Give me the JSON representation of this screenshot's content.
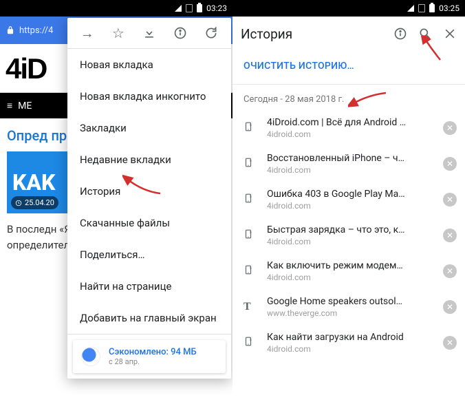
{
  "left": {
    "status": {
      "time": "03:23"
    },
    "urlbar": {
      "url": "https://4"
    },
    "page": {
      "logo": "4iD",
      "nav": "MЕ",
      "headline": "Опред\nприло:\nна And",
      "img_text": "KAK",
      "date": "25.04.20",
      "paragraph": "В последн\n«Яндекс» на Android появился определитель номеров. Функция"
    },
    "menu": {
      "items": [
        "Новая вкладка",
        "Новая вкладка инкогнито",
        "Закладки",
        "Недавние вкладки",
        "История",
        "Скачанные файлы",
        "Поделиться…",
        "Найти на странице",
        "Добавить на главный экран"
      ],
      "saved": {
        "line1": "Сэкономлено: 94 МБ",
        "line2": "с 28 апр."
      }
    }
  },
  "right": {
    "status": {
      "time": "03:25"
    },
    "header": {
      "title": "История"
    },
    "clear": "ОЧИСТИТЬ ИСТОРИЮ…",
    "date": "Сегодня - 28 мая 2018 г.",
    "items": [
      {
        "icon": "phone",
        "title": "4iDroid.com | Всё для Android …",
        "domain": "4idroid.com"
      },
      {
        "icon": "phone",
        "title": "Восстановленный iPhone – ч…",
        "domain": "4idroid.com"
      },
      {
        "icon": "phone",
        "title": "Ошибка 403 в Google Play Ма…",
        "domain": "4idroid.com"
      },
      {
        "icon": "phone",
        "title": "Быстрая зарядка – что это, к…",
        "domain": "4idroid.com"
      },
      {
        "icon": "phone",
        "title": "Как включить режим модем…",
        "domain": "4idroid.com"
      },
      {
        "icon": "T",
        "title": "Google Home speakers outsol…",
        "domain": "www.theverge.com"
      },
      {
        "icon": "phone",
        "title": "Как найти загрузки на Android",
        "domain": "4idroid.com"
      }
    ]
  }
}
